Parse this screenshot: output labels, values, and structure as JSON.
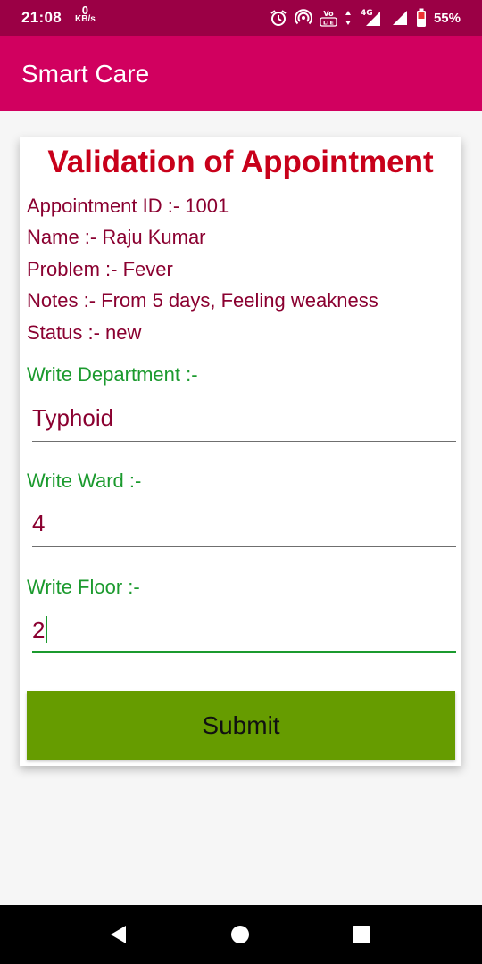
{
  "status_bar": {
    "time": "21:08",
    "net_speed_value": "0",
    "net_speed_unit": "KB/s",
    "volte_label": "VoLTE",
    "network_type": "4G",
    "battery_percent": "55%",
    "icons": [
      "alarm-icon",
      "hotspot-icon",
      "volte-icon",
      "data-arrows-icon",
      "signal-icon",
      "battery-icon"
    ]
  },
  "app_bar": {
    "title": "Smart Care"
  },
  "card": {
    "heading": "Validation of Appointment",
    "appointment_id": "Appointment ID :- 1001",
    "name": "Name :- Raju Kumar",
    "problem": "Problem :- Fever",
    "notes": "Notes :- From 5 days, Feeling weakness",
    "status": "Status :- new",
    "department_label": "Write Department :-",
    "department_value": "Typhoid",
    "ward_label": "Write Ward :-",
    "ward_value": "4",
    "floor_label": "Write Floor :-",
    "floor_value": "2",
    "submit_label": "Submit"
  },
  "nav_bar": {
    "icons": [
      "back-icon",
      "home-icon",
      "recents-icon"
    ]
  },
  "colors": {
    "status_bar": "#9b0045",
    "app_bar": "#d1005f",
    "heading": "#c8001a",
    "info_text": "#8a0030",
    "label_green": "#1b9a2e",
    "submit_bg": "#669c00"
  }
}
